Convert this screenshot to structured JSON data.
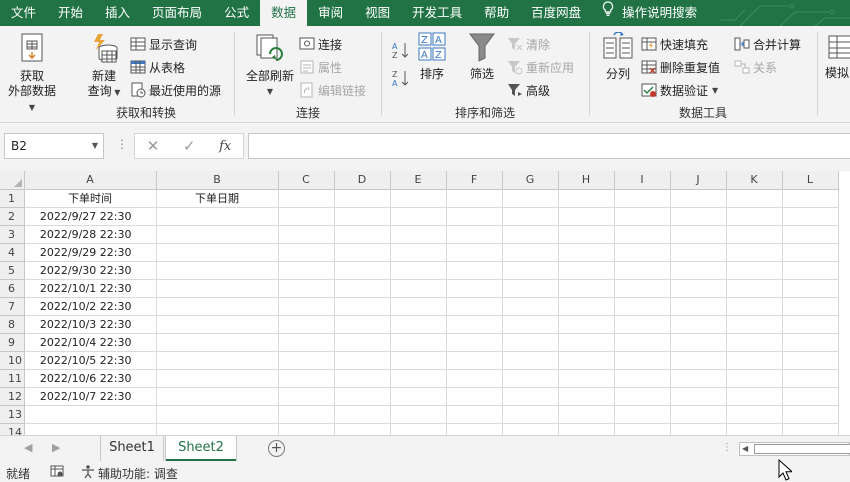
{
  "menu": {
    "tabs": [
      "文件",
      "开始",
      "插入",
      "页面布局",
      "公式",
      "数据",
      "审阅",
      "视图",
      "开发工具",
      "帮助",
      "百度网盘"
    ],
    "active": "数据",
    "search_label": "操作说明搜索"
  },
  "ribbon": {
    "groups": {
      "get_transform": {
        "label": "获取和转换",
        "get_external": [
          "获取",
          "外部数据"
        ],
        "new_query": [
          "新建",
          "查询"
        ],
        "show_query": "显示查询",
        "from_table": "从表格",
        "recent_sources": "最近使用的源"
      },
      "connections": {
        "label": "连接",
        "refresh_all": "全部刷新",
        "connections": "连接",
        "properties": "属性",
        "edit_links": "编辑链接"
      },
      "sort_filter": {
        "label": "排序和筛选",
        "sort": "排序",
        "filter": "筛选",
        "clear": "清除",
        "reapply": "重新应用",
        "advanced": "高级"
      },
      "data_tools": {
        "label": "数据工具",
        "text_to_columns": "分列",
        "flash_fill": "快速填充",
        "remove_duplicates": "删除重复值",
        "data_validation": "数据验证",
        "consolidate": "合并计算",
        "relationships": "关系"
      },
      "forecast": {
        "what_if": "模拟"
      }
    }
  },
  "formula_bar": {
    "name_box": "B2",
    "fx_label": "fx",
    "formula": ""
  },
  "grid": {
    "columns": [
      "A",
      "B",
      "C",
      "D",
      "E",
      "F",
      "G",
      "H",
      "I",
      "J",
      "K",
      "L"
    ],
    "row_numbers": [
      "1",
      "2",
      "3",
      "4",
      "5",
      "6",
      "7",
      "8",
      "9",
      "10",
      "11",
      "12",
      "13",
      "14"
    ],
    "header_A": "下单时间",
    "header_B": "下单日期",
    "dates": [
      "2022/9/27 22:30",
      "2022/9/28 22:30",
      "2022/9/29 22:30",
      "2022/9/30 22:30",
      "2022/10/1 22:30",
      "2022/10/2 22:30",
      "2022/10/3 22:30",
      "2022/10/4 22:30",
      "2022/10/5 22:30",
      "2022/10/6 22:30",
      "2022/10/7 22:30"
    ]
  },
  "sheets": {
    "tabs": [
      "Sheet1",
      "Sheet2"
    ],
    "active": "Sheet2"
  },
  "status": {
    "ready": "就绪",
    "accessibility": "辅助功能: 调查"
  },
  "colors": {
    "brand": "#217346",
    "ribbon_bg": "#f3f3f3"
  }
}
